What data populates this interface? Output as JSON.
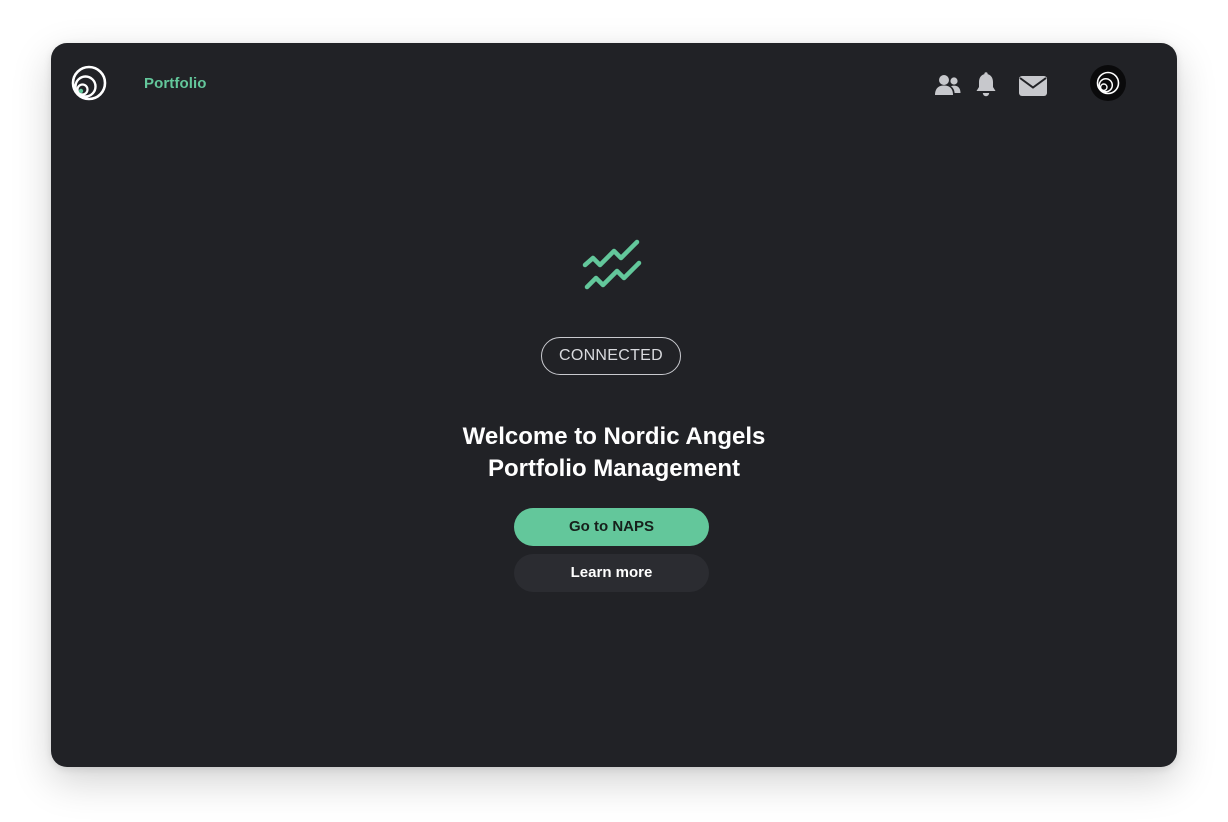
{
  "topbar": {
    "nav_label": "Portfolio",
    "icons": [
      "logo-icon",
      "users-icon",
      "bell-icon",
      "mail-icon",
      "avatar-logo-icon"
    ]
  },
  "main": {
    "hero_icon": "trend-up-icon",
    "status_label": "CONNECTED",
    "welcome_line1": "Welcome to Nordic Angels",
    "welcome_line2": "Portfolio Management",
    "primary_button": "Go to NAPS",
    "secondary_button": "Learn more"
  },
  "colors": {
    "accent": "#63c79b",
    "background": "#212226",
    "secondary_button": "#2b2c31",
    "icon_gray": "#c7c8cc"
  }
}
